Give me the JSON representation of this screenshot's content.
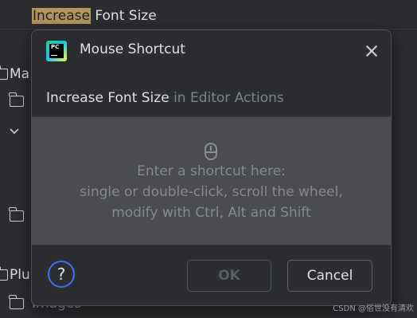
{
  "background": {
    "search_highlight": "Increase",
    "search_rest": " Font Size",
    "rows": [
      {
        "label": "Ma"
      },
      {
        "label": "Plu"
      },
      {
        "label": "Images"
      }
    ],
    "watermark": "CSDN @俗世没有清欢"
  },
  "dialog": {
    "title": "Mouse Shortcut",
    "action_name": "Increase Font Size",
    "action_context": " in Editor Actions",
    "hint_line1": "Enter a shortcut here:",
    "hint_line2": "single or double-click, scroll the wheel,",
    "hint_line3": "modify with Ctrl, Alt and Shift",
    "help_label": "?",
    "ok_label": "OK",
    "cancel_label": "Cancel",
    "ok_enabled": false
  },
  "colors": {
    "accent": "#3574f0",
    "highlight": "#b4955a",
    "dialog_bg": "#2b2d30",
    "shortcut_area_bg": "#4a4c50"
  },
  "icons": {
    "app": "pycharm-logo-icon",
    "close": "close-icon",
    "mouse": "mouse-icon",
    "help": "help-icon",
    "folder": "folder-icon",
    "chevron": "chevron-down-icon"
  }
}
